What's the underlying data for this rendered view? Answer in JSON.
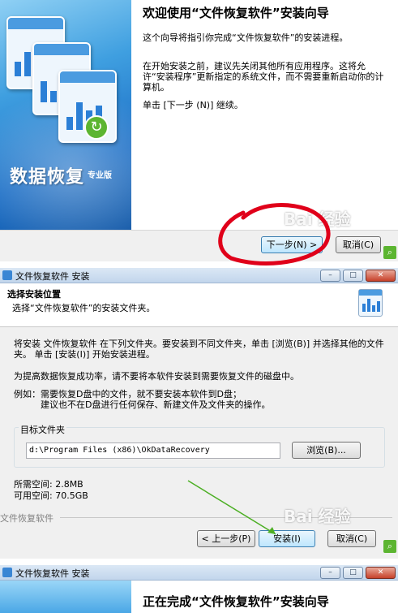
{
  "panel1": {
    "brand": {
      "main": "数据恢复",
      "sub": "专业版"
    },
    "title": "欢迎使用“文件恢复软件”安装向导",
    "paragraphs": [
      "这个向导将指引你完成“文件恢复软件”的安装进程。",
      "在开始安装之前，建议先关闭其他所有应用程序。这将允许“安装程序”更新指定的系统文件，而不需要重新启动你的计算机。",
      "单击 [下一步 (N)] 继续。"
    ],
    "buttons": {
      "next": "下一步(N) >",
      "cancel": "取消(C)"
    },
    "watermark": "Bai 经验"
  },
  "panel2": {
    "window_title": "文件恢复软件 安装",
    "window_buttons": {
      "minimize": "–",
      "maximize": "□",
      "close": "✕"
    },
    "header": {
      "title": "选择安装位置",
      "subtitle": "选择“文件恢复软件”的安装文件夹。"
    },
    "body": {
      "intro": "将安装 文件恢复软件 在下列文件夹。要安装到不同文件夹，单击 [浏览(B)] 并选择其他的文件夹。 单击 [安装(I)] 开始安装进程。",
      "tip": "为提高数据恢复成功率，请不要将本软件安装到需要恢复文件的磁盘中。",
      "example": "例如：需要恢复D盘中的文件，就不要安装本软件到D盘；\n　　　建议也不在D盘进行任何保存、新建文件及文件夹的操作。"
    },
    "target_folder": {
      "label": "目标文件夹",
      "path": "d:\\Program Files (x86)\\OkDataRecovery",
      "browse_button": "浏览(B)..."
    },
    "space": {
      "required": "所需空间: 2.8MB",
      "available": "可用空间: 70.5GB"
    },
    "footer_brand": "文件恢复软件",
    "buttons": {
      "back": "< 上一步(P)",
      "install": "安装(I)",
      "cancel": "取消(C)"
    },
    "watermark": "Bai 经验"
  },
  "panel3": {
    "window_title": "文件恢复软件 安装",
    "window_buttons": {
      "minimize": "–",
      "maximize": "□",
      "close": "✕"
    },
    "title": "正在完成“文件恢复软件”安装向导"
  },
  "colors": {
    "banner_blue": "#1d6fc6",
    "annotation_red": "#e0001a",
    "arrow_green": "#4caf24",
    "titlebar": "#c2d6ec"
  }
}
